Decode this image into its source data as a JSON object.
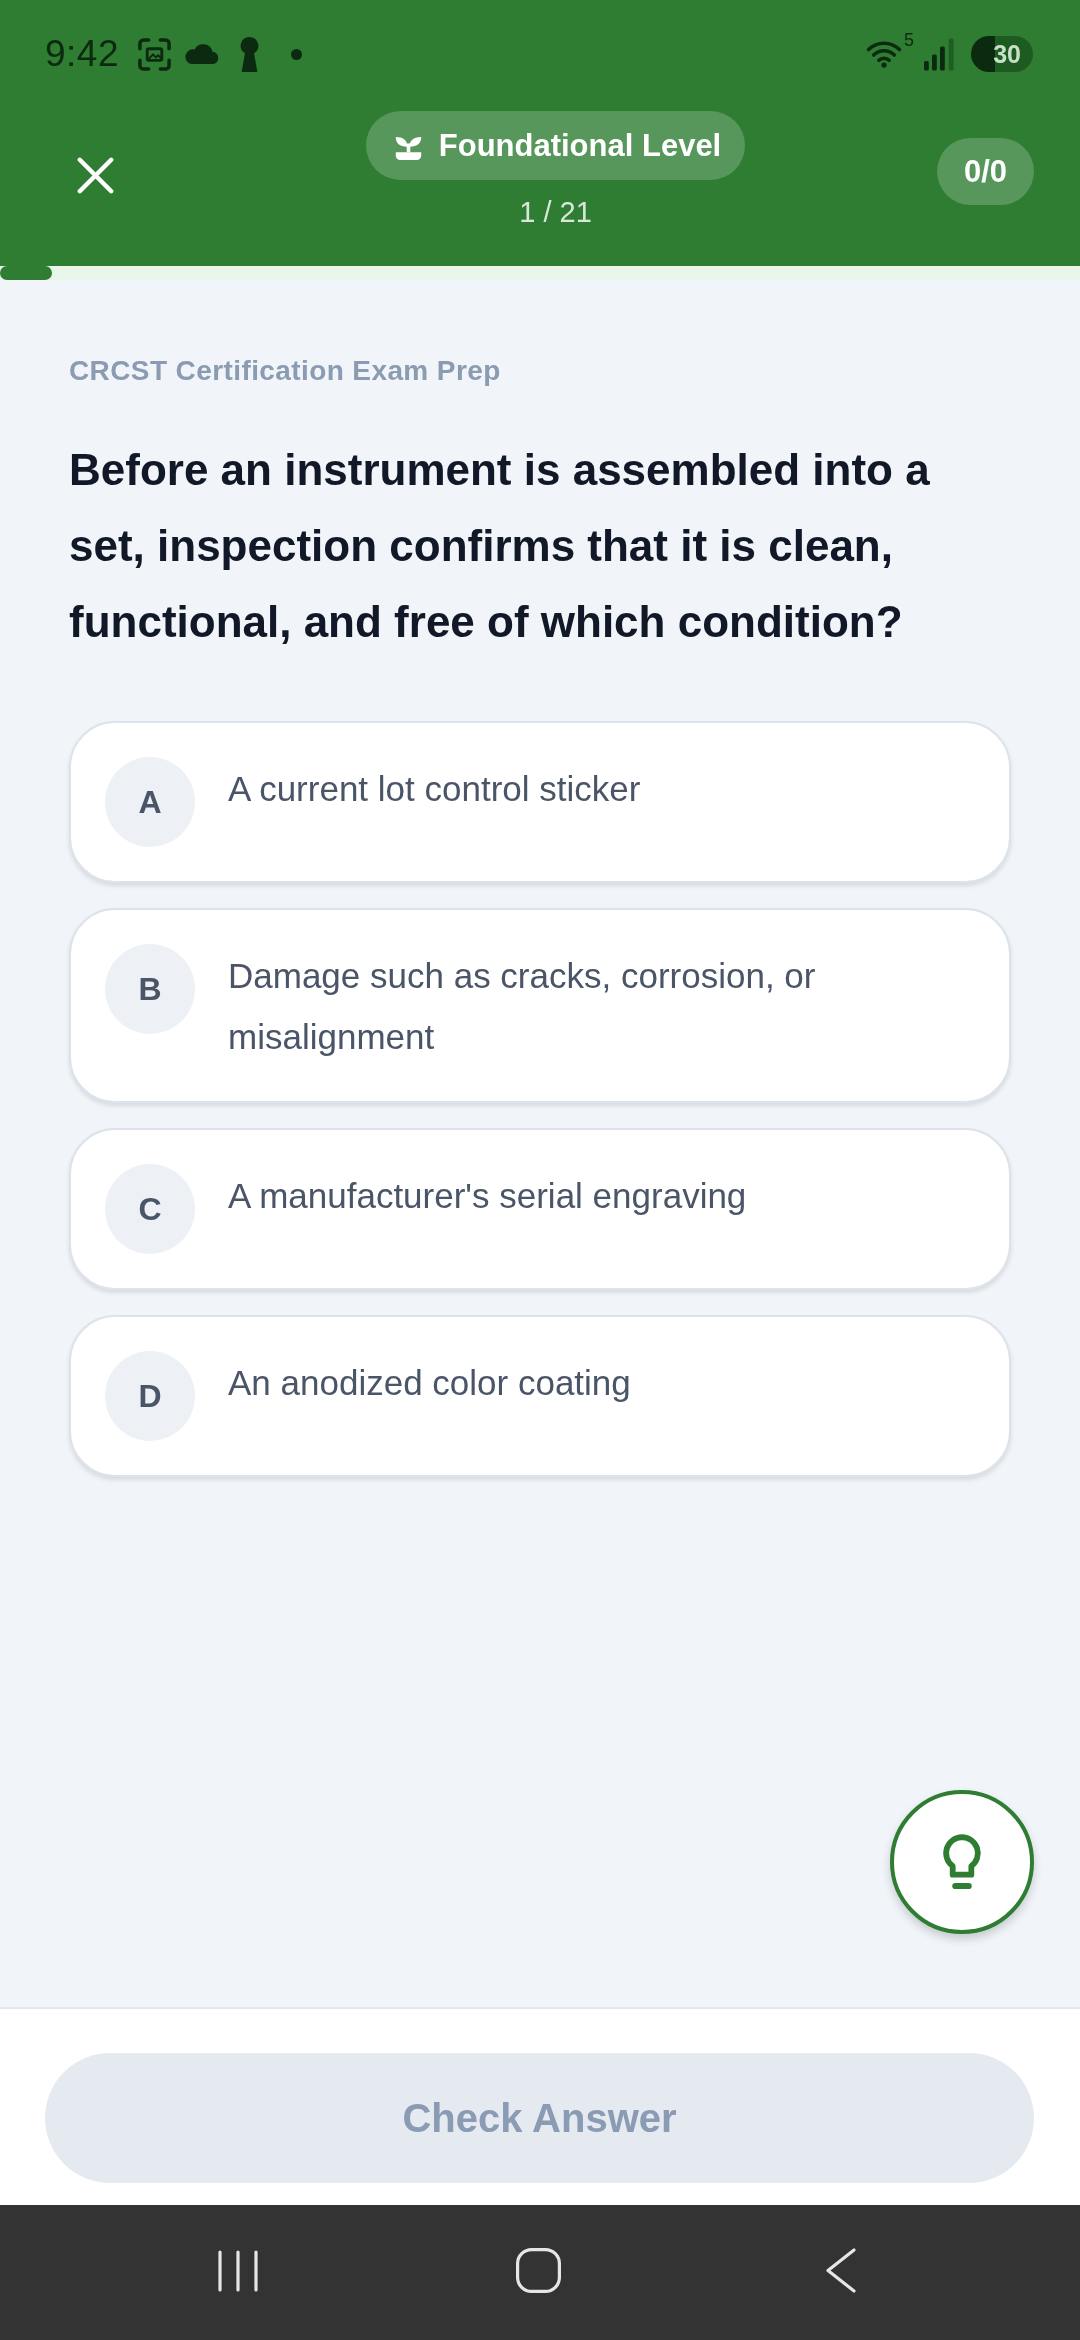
{
  "status_bar": {
    "time": "9:42",
    "network_type": "5",
    "battery": "30"
  },
  "header": {
    "level_badge": "Foundational Level",
    "question_counter": "1 / 21",
    "score": "0/0"
  },
  "progress": {
    "level": 0.048
  },
  "question": {
    "category": "CRCST Certification Exam Prep",
    "text": "Before an instrument is assembled into a set, inspection confirms that it is clean, functional, and free of which condition?"
  },
  "options": [
    {
      "letter": "A",
      "text": "A current lot control sticker",
      "selected": false
    },
    {
      "letter": "B",
      "text": "Damage such as cracks, corrosion, or misalignment",
      "selected": false
    },
    {
      "letter": "C",
      "text": "A manufacturer's serial engraving",
      "selected": false
    },
    {
      "letter": "D",
      "text": "An anodized color coating",
      "selected": false
    }
  ],
  "check_button": {
    "label": "Check Answer",
    "disabled": true
  }
}
